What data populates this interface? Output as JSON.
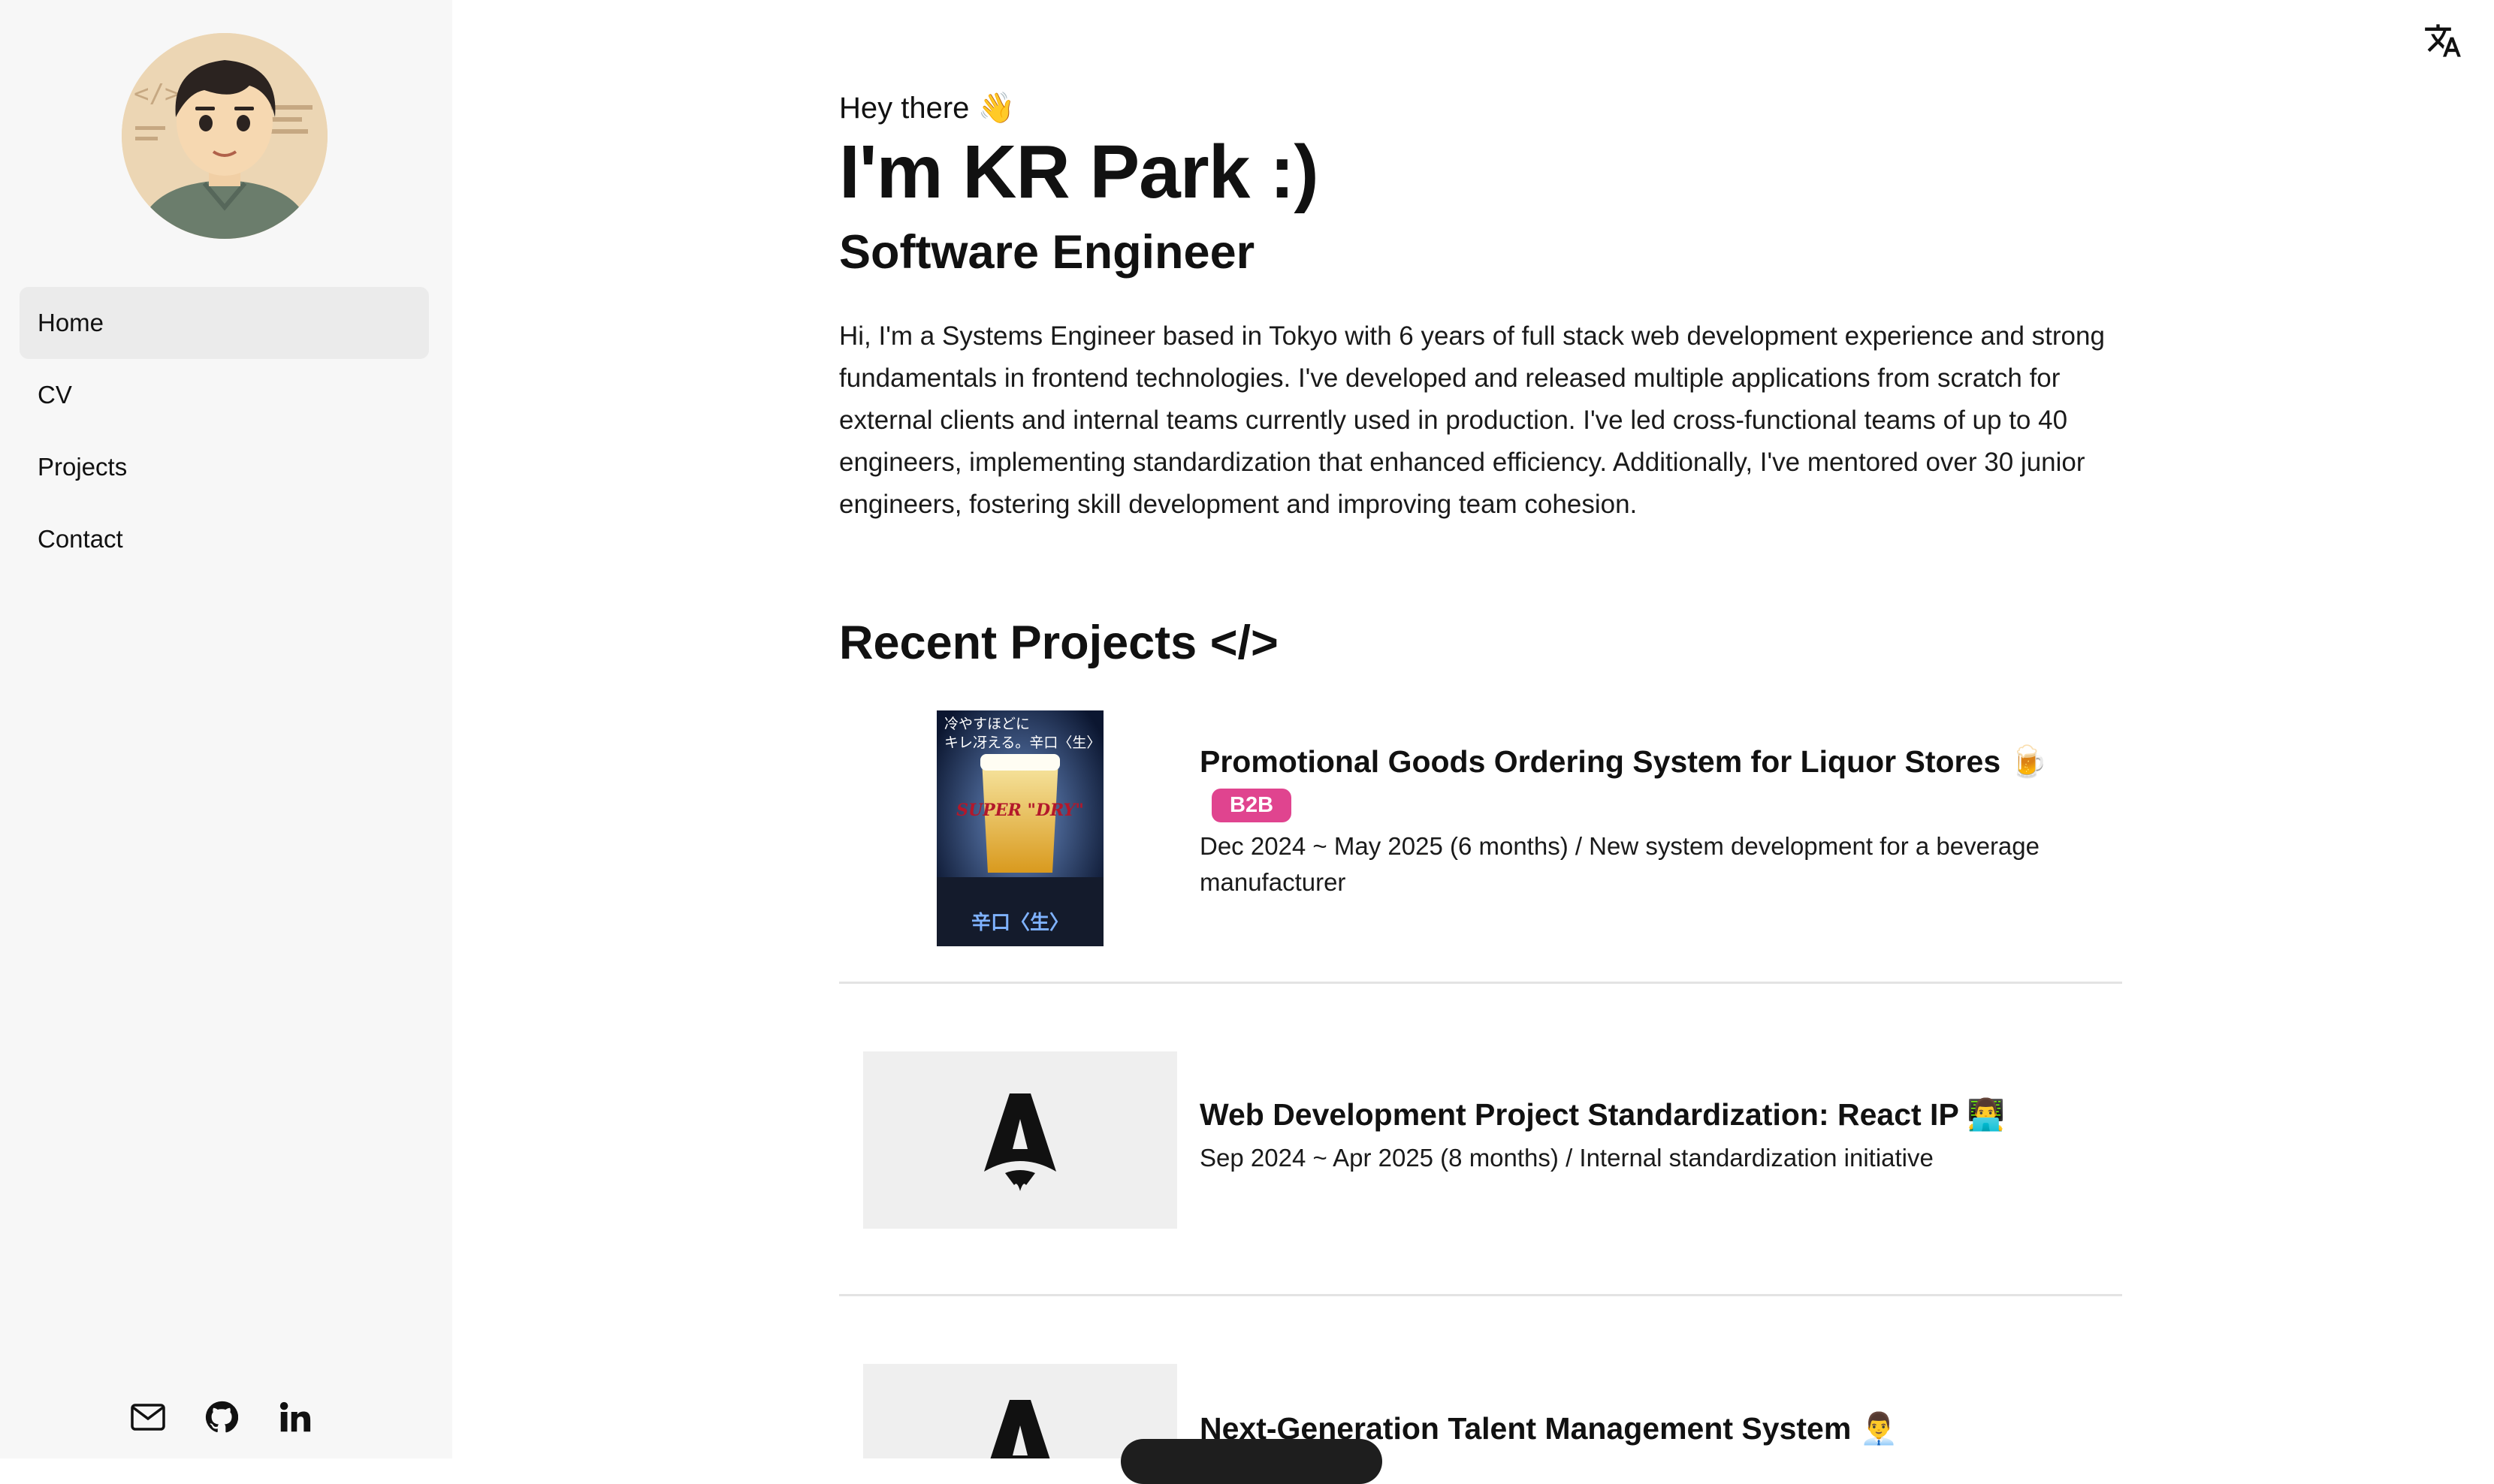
{
  "sidebar": {
    "nav": [
      {
        "label": "Home",
        "active": true
      },
      {
        "label": "CV",
        "active": false
      },
      {
        "label": "Projects",
        "active": false
      },
      {
        "label": "Contact",
        "active": false
      }
    ],
    "socials": [
      "mail-icon",
      "github-icon",
      "linkedin-icon"
    ]
  },
  "header": {
    "translate_icon": "translate-icon"
  },
  "hero": {
    "greeting": "Hey there 👋",
    "name": "I'm KR Park :)",
    "role": "Software Engineer",
    "bio": "Hi, I'm a Systems Engineer based in Tokyo with 6 years of full stack web development experience and strong fundamentals in frontend technologies. I've developed and released multiple applications from scratch for external clients and internal teams currently used in production. I've led cross-functional teams of up to 40 engineers, implementing standardization that enhanced efficiency. Additionally, I've mentored over 30 junior engineers, fostering skill development and improving team cohesion."
  },
  "recent_projects": {
    "title": "Recent Projects </>",
    "items": [
      {
        "title": "Promotional Goods Ordering System for Liquor Stores 🍺",
        "badge": "B2B",
        "meta": "Dec 2024 ~ May 2025 (6 months) / New system development for a beverage manufacturer",
        "poster_text_top": "冷やすほどに\nキレ冴える。辛口〈生〉",
        "poster_brand": "SUPER \"DRY\"",
        "poster_text_bottom": "辛口〈生〉"
      },
      {
        "title": "Web Development Project Standardization: React IP 👨‍💻",
        "meta": "Sep 2024 ~ Apr 2025 (8 months) / Internal standardization initiative"
      },
      {
        "title": "Next-Generation Talent Management System 👨‍💼"
      }
    ]
  },
  "colors": {
    "sidebar_bg": "#f7f7f7",
    "nav_active_bg": "#ebebeb",
    "badge_bg": "#e0448f",
    "divider": "#e3e3e3"
  }
}
